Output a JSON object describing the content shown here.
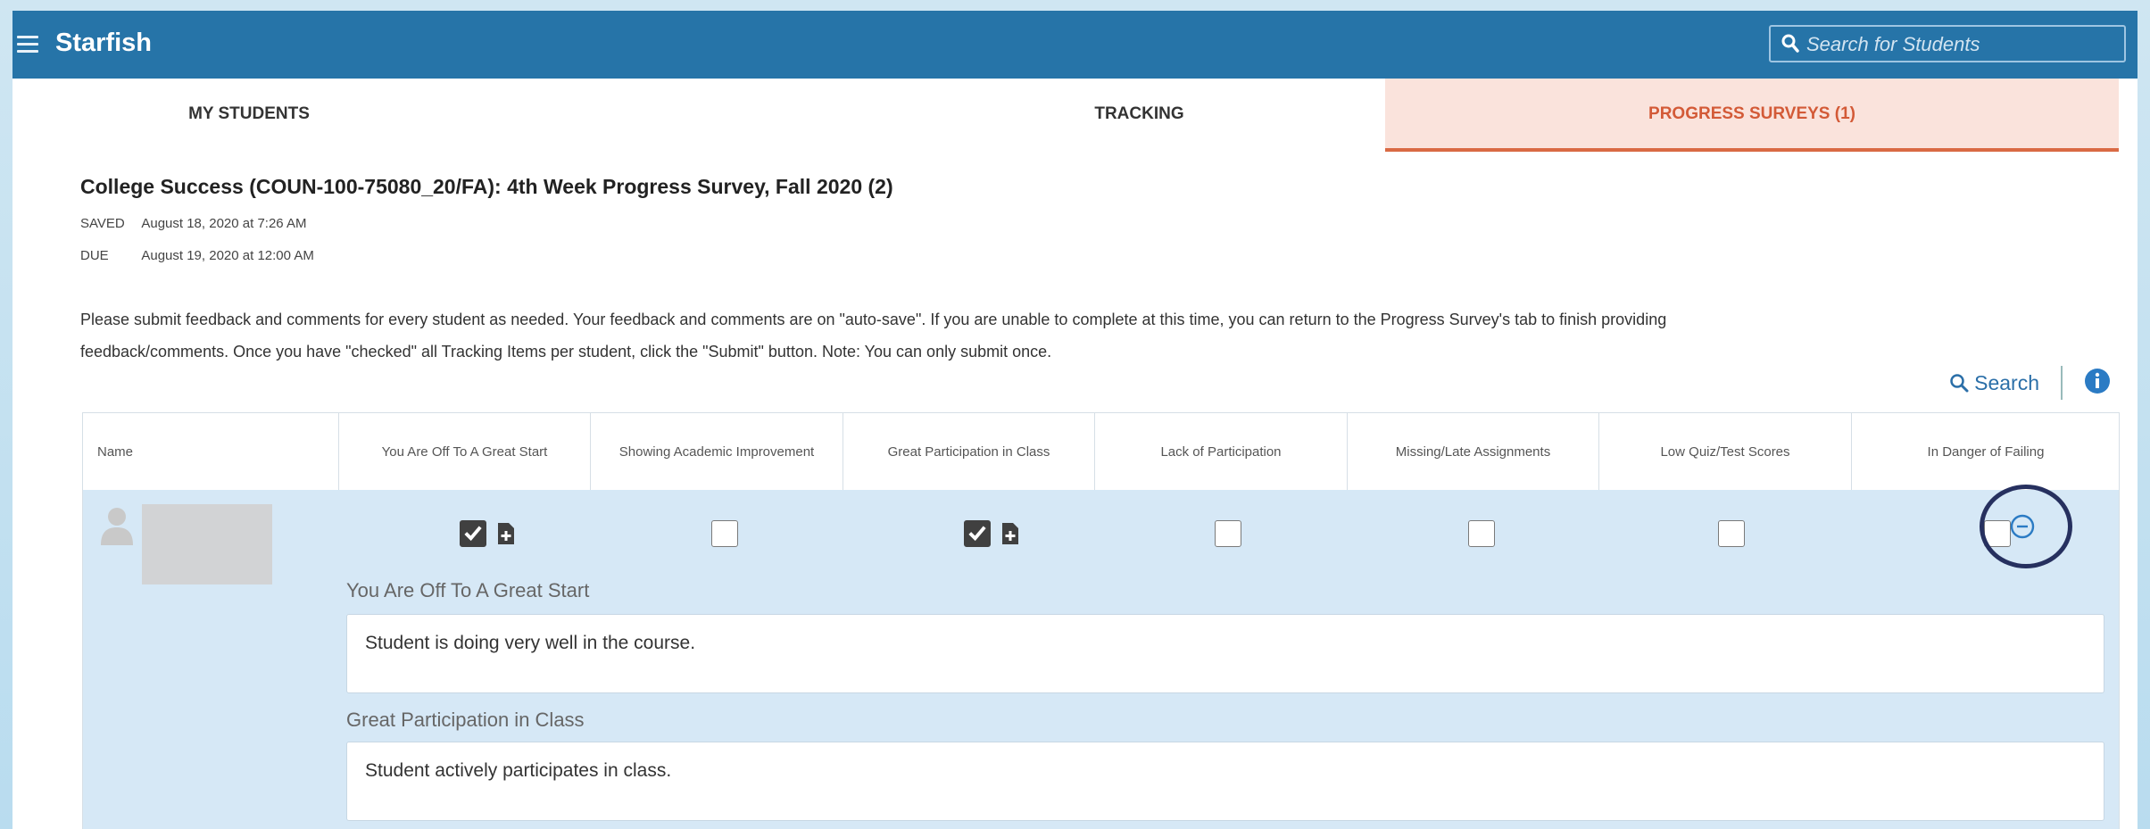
{
  "app": {
    "title": "Starfish"
  },
  "search": {
    "placeholder": "Search for Students"
  },
  "tabs": [
    {
      "label": "MY STUDENTS"
    },
    {
      "label": "TRACKING"
    },
    {
      "label": "PROGRESS SURVEYS (1)",
      "active": true
    }
  ],
  "survey": {
    "title": "College Success (COUN-100-75080_20/FA): 4th Week Progress Survey, Fall 2020 (2)",
    "saved_label": "SAVED",
    "saved_value": "August 18, 2020 at 7:26 AM",
    "due_label": "DUE",
    "due_value": "August 19, 2020 at 12:00 AM",
    "instructions_line1": "Please submit feedback and comments for every student as needed. Your feedback and comments are on \"auto-save\". If you are unable to complete at this time, you can return to the Progress Survey's tab to finish providing",
    "instructions_line2": "feedback/comments. Once you have \"checked\" all Tracking Items per student, click the \"Submit\" button. Note: You can only submit once."
  },
  "toolbar": {
    "search_label": "Search"
  },
  "table": {
    "columns": [
      "Name",
      "You Are Off To A Great Start",
      "Showing Academic Improvement",
      "Great Participation in Class",
      "Lack of Participation",
      "Missing/Late Assignments",
      "Low Quiz/Test Scores",
      "In Danger of Failing"
    ],
    "row": {
      "checked": [
        true,
        false,
        true,
        false,
        false,
        false,
        false
      ],
      "feedback": [
        {
          "label": "You Are Off To A Great Start",
          "comment": "Student is doing very well in the course."
        },
        {
          "label": "Great Participation in Class",
          "comment": "Student actively participates in class."
        }
      ]
    }
  },
  "colors": {
    "topbar": "#2674a8",
    "active_tab_bg": "#fae3dc",
    "active_tab_text": "#d35a37",
    "row_bg": "#d6e8f6",
    "link": "#2b6fa8",
    "highlight_circle": "#26305f"
  }
}
